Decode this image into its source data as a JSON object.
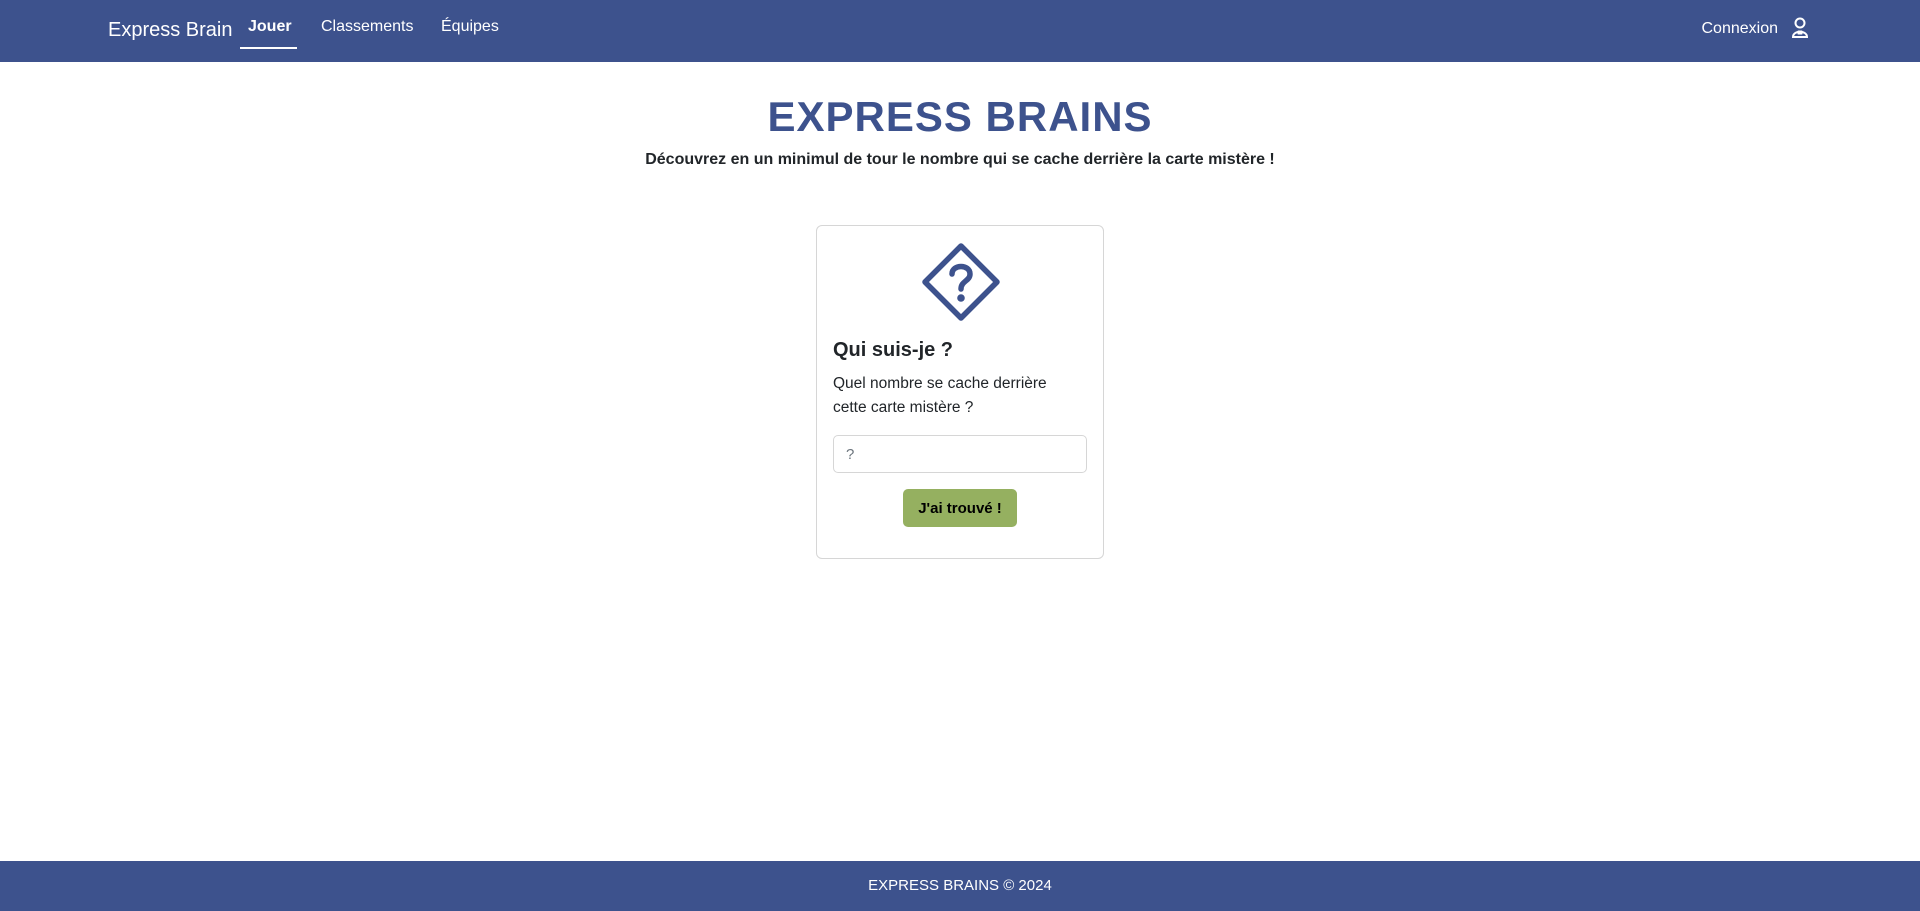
{
  "navbar": {
    "brand": "Express Brain",
    "links": [
      {
        "label": "Jouer",
        "active": true
      },
      {
        "label": "Classements",
        "active": false
      },
      {
        "label": "Équipes",
        "active": false
      }
    ],
    "login_label": "Connexion",
    "login_icon": "user-lock-icon"
  },
  "header": {
    "title": "EXPRESS BRAINS",
    "subtitle": "Découvrez en un minimul de tour le nombre qui se cache derrière la carte mistère !"
  },
  "card": {
    "icon": "question-diamond-icon",
    "title": "Qui suis-je ?",
    "text": "Quel nombre se cache derrière cette carte mistère ?",
    "input_placeholder": "?",
    "input_value": "",
    "button_label": "J'ai trouvé !"
  },
  "footer": {
    "text": "EXPRESS BRAINS © 2024"
  },
  "colors": {
    "primary": "#3d528d",
    "button": "#95b060",
    "border": "#d6d6d6"
  }
}
